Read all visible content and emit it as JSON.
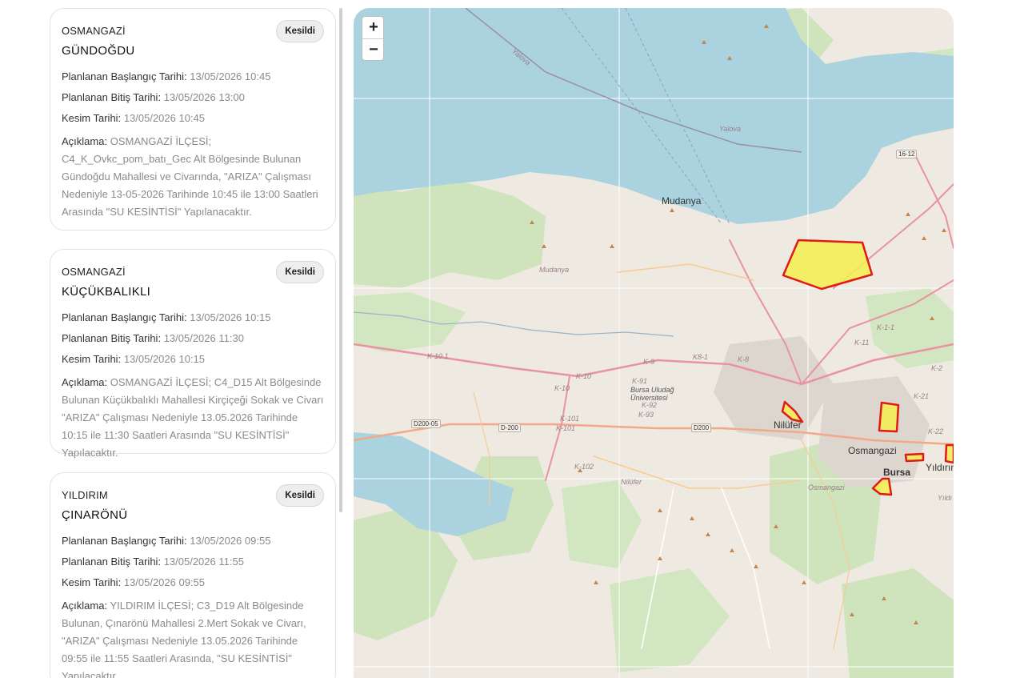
{
  "outages": [
    {
      "district": "OSMANGAZİ",
      "neighborhood": "GÜNDOĞDU",
      "status": "Kesildi",
      "start_label": "Planlanan Başlangıç Tarihi:",
      "start_value": "13/05/2026 10:45",
      "end_label": "Planlanan Bitiş Tarihi:",
      "end_value": "13/05/2026 13:00",
      "cut_label": "Kesim Tarihi:",
      "cut_value": "13/05/2026 10:45",
      "desc_label": "Açıklama:",
      "desc_value": "OSMANGAZİ İLÇESİ; C4_K_Ovkc_pom_batı_Gec Alt Bölgesinde Bulunan Gündoğdu Mahallesi ve Civarında, \"ARIZA\" Çalışması Nedeniyle 13-05-2026 Tarihinde 10:45 ile 13:00 Saatleri Arasında \"SU KESİNTİSİ\" Yapılanacaktır."
    },
    {
      "district": "OSMANGAZİ",
      "neighborhood": "KÜÇÜKBALIKLI",
      "status": "Kesildi",
      "start_label": "Planlanan Başlangıç Tarihi:",
      "start_value": "13/05/2026 10:15",
      "end_label": "Planlanan Bitiş Tarihi:",
      "end_value": "13/05/2026 11:30",
      "cut_label": "Kesim Tarihi:",
      "cut_value": "13/05/2026 10:15",
      "desc_label": "Açıklama:",
      "desc_value": "OSMANGAZİ İLÇESİ; C4_D15 Alt Bölgesinde Bulunan Küçükbalıklı Mahallesi Kirçiçeği Sokak ve Civarı \"ARIZA\" Çalışması Nedeniyle 13.05.2026 Tarihinde 10:15 ile 11:30 Saatleri Arasında \"SU KESİNTİSİ\" Yapılacaktır."
    },
    {
      "district": "YILDIRIM",
      "neighborhood": "ÇINARÖNÜ",
      "status": "Kesildi",
      "start_label": "Planlanan Başlangıç Tarihi:",
      "start_value": "13/05/2026 09:55",
      "end_label": "Planlanan Bitiş Tarihi:",
      "end_value": "13/05/2026 11:55",
      "cut_label": "Kesim Tarihi:",
      "cut_value": "13/05/2026 09:55",
      "desc_label": "Açıklama:",
      "desc_value": "YILDIRIM İLÇESİ; C3_D19 Alt Bölgesinde Bulunan, Çınarönü Mahallesi 2.Mert Sokak ve Civarı, \"ARIZA\" Çalışması Nedeniyle 13.05.2026 Tarihinde 09:55 ile 11:55 Saatleri Arasında, \"SU KESİNTİSİ\" Yapılacaktır."
    }
  ],
  "map": {
    "zoom_in": "+",
    "zoom_out": "−",
    "labels": {
      "yalova1": "Yalova",
      "yalova2": "Yalova",
      "mudanya": "Mudanya",
      "mudanya2": "Mudanya",
      "nilufer": "Nilüfer",
      "nilufer2": "Nilüfer",
      "osmangazi": "Osmangazi",
      "osmangazi2": "Osmangazi",
      "bursa": "Bursa",
      "yildirim": "Yıldırım",
      "yildirim2": "Yıldı",
      "uludag": "Bursa Uludağ Üniversitesi",
      "r1612": "16-12",
      "d20005": "D200-05",
      "d200a": "D-200",
      "d200b": "D200",
      "k101a": "K-10.1",
      "k10": "K-10",
      "k10b": "K-10",
      "k101": "K-101",
      "k1012": "K-101",
      "k102": "K-102",
      "k9": "K-9",
      "k91": "K-91",
      "k92": "K-92",
      "k93": "K-93",
      "k8": "K-8",
      "k81": "K8-1",
      "k11": "K-11",
      "k111": "K-1-1",
      "k2": "K-2",
      "k21": "K-21",
      "k22": "K-22"
    }
  }
}
